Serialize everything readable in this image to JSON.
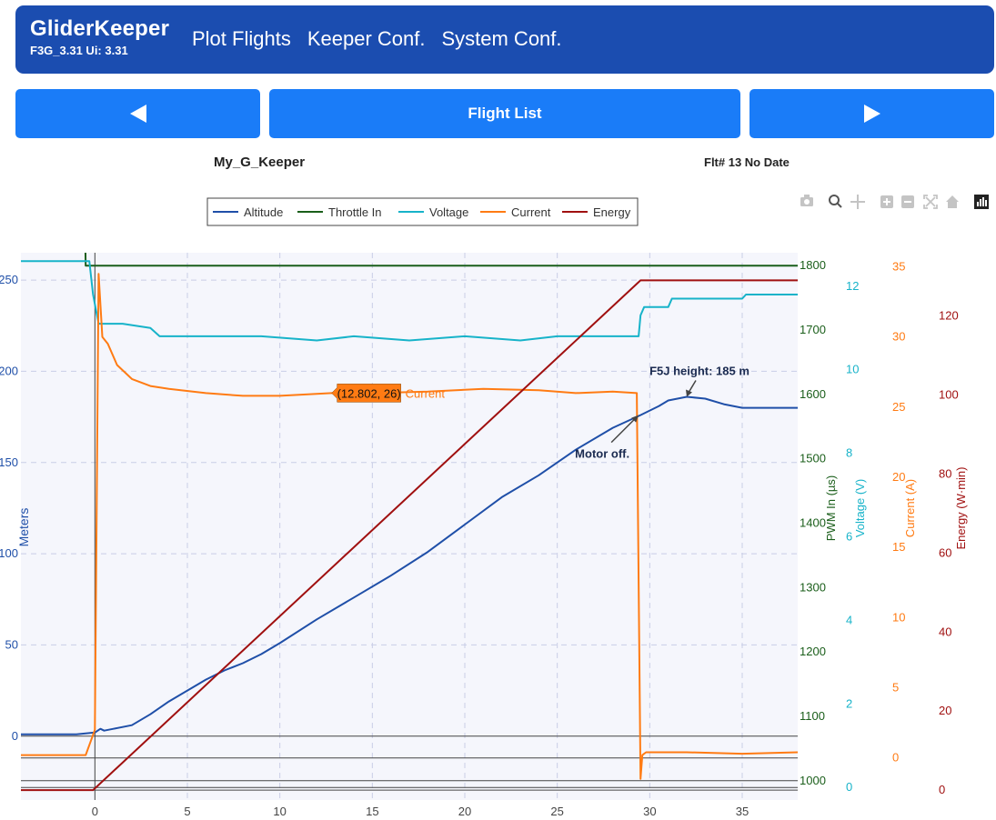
{
  "header": {
    "brand": "GliderKeeper",
    "version": "F3G_3.31 Ui: 3.31",
    "nav": [
      "Plot Flights",
      "Keeper Conf.",
      "System Conf."
    ]
  },
  "buttons": {
    "prev_icon": "triangle-left-icon",
    "list_label": "Flight List",
    "next_icon": "triangle-right-icon"
  },
  "info": {
    "keeper": "My_G_Keeper",
    "flight": "Flt# 13 No Date"
  },
  "toolbar": [
    "camera-icon",
    "zoom-icon",
    "pan-icon",
    "zoom-in-icon",
    "zoom-out-icon",
    "autoscale-icon",
    "home-icon",
    "plotly-logo-icon"
  ],
  "colors": {
    "altitude": "#1f4fa8",
    "throttle": "#1a5e1a",
    "voltage": "#17b3c9",
    "current": "#ff7b13",
    "energy": "#a01010",
    "plot_bg": "#f5f6fc"
  },
  "chart_data": {
    "type": "line",
    "legend": [
      "Altitude",
      "Throttle In",
      "Voltage",
      "Current",
      "Energy"
    ],
    "legend_position": "top",
    "x_ticks": [
      "0",
      "5",
      "10",
      "15",
      "20",
      "25",
      "30",
      "35"
    ],
    "xlim": [
      -4,
      38
    ],
    "axes": {
      "y1": {
        "label": "Meters",
        "ticks": [
          "0",
          "50",
          "100",
          "150",
          "200",
          "250"
        ],
        "range": [
          -35,
          265
        ]
      },
      "y2": {
        "label": "PWM In (µs)",
        "ticks": [
          "1000",
          "1100",
          "1200",
          "1300",
          "1400",
          "1500",
          "1600",
          "1700",
          "1800"
        ],
        "range": [
          970,
          1820
        ]
      },
      "y3": {
        "label": "Voltage (V)",
        "ticks": [
          "0",
          "2",
          "4",
          "6",
          "8",
          "10",
          "12"
        ],
        "range": [
          -0.3,
          12.8
        ]
      },
      "y4": {
        "label": "Current (A)",
        "ticks": [
          "0",
          "5",
          "10",
          "15",
          "20",
          "25",
          "30",
          "35"
        ],
        "range": [
          -3,
          36
        ]
      },
      "y5": {
        "label": "Energy (W·min)",
        "ticks": [
          "0",
          "20",
          "40",
          "60",
          "80",
          "100",
          "120"
        ],
        "range": [
          -2.5,
          136
        ]
      }
    },
    "series": [
      {
        "name": "Altitude",
        "axis": "y1",
        "x": [
          -4,
          -1,
          0,
          0.3,
          0.5,
          1,
          2,
          3,
          4,
          5,
          6,
          7,
          8,
          9,
          10,
          12,
          14,
          16,
          18,
          20,
          22,
          24,
          26,
          28,
          29.5,
          30.5,
          31,
          32,
          33,
          34,
          35,
          36,
          37,
          38
        ],
        "y": [
          1,
          1,
          2,
          4,
          3,
          4,
          6,
          12,
          19,
          25,
          31,
          36,
          40,
          45,
          51,
          64,
          76,
          88,
          101,
          116,
          131,
          143,
          157,
          169,
          176,
          181,
          184,
          186,
          185,
          182,
          180,
          180,
          180,
          180
        ]
      },
      {
        "name": "Throttle In",
        "axis": "y2",
        "x": [
          -4,
          -0.6,
          -0.5,
          38
        ],
        "y": [
          1980,
          1980,
          1800,
          1800
        ]
      },
      {
        "name": "Voltage",
        "axis": "y3",
        "x": [
          -4,
          -0.3,
          -0.1,
          0.2,
          1.5,
          3,
          3.5,
          7,
          9,
          12,
          14,
          17,
          20,
          23,
          25,
          29,
          29.4,
          29.5,
          29.7,
          31,
          31.2,
          35,
          35.2,
          38
        ],
        "y": [
          12.6,
          12.6,
          11.8,
          11.1,
          11.1,
          11.0,
          10.8,
          10.8,
          10.8,
          10.7,
          10.8,
          10.7,
          10.8,
          10.7,
          10.8,
          10.8,
          10.8,
          11.3,
          11.5,
          11.5,
          11.7,
          11.7,
          11.8,
          11.8
        ]
      },
      {
        "name": "Current",
        "axis": "y4",
        "x": [
          -4,
          -0.5,
          0,
          0.2,
          0.4,
          0.7,
          1.2,
          2,
          3,
          4,
          6,
          8,
          10,
          12.8,
          15,
          18,
          21,
          24,
          26,
          28,
          29.3,
          29.5,
          29.6,
          29.8,
          32,
          35,
          38
        ],
        "y": [
          0.2,
          0.2,
          2,
          34.5,
          30,
          29.5,
          28,
          27,
          26.5,
          26.3,
          26,
          25.8,
          25.8,
          26,
          26,
          26.1,
          26.3,
          26.2,
          26,
          26.1,
          26,
          -1.5,
          0.2,
          0.4,
          0.4,
          0.3,
          0.4
        ]
      },
      {
        "name": "Energy",
        "axis": "y5",
        "x": [
          -4,
          -0.1,
          29.5,
          38
        ],
        "y": [
          0,
          0,
          129,
          129
        ]
      }
    ],
    "annotations": [
      {
        "text": "F5J height: 185 m",
        "x": 32,
        "y": 186,
        "axis": "y1"
      },
      {
        "text": "Motor off.",
        "x": 29.4,
        "y": 176,
        "axis": "y1"
      }
    ],
    "hover_label": {
      "text": "(12.802, 26)",
      "series": "Current"
    }
  }
}
